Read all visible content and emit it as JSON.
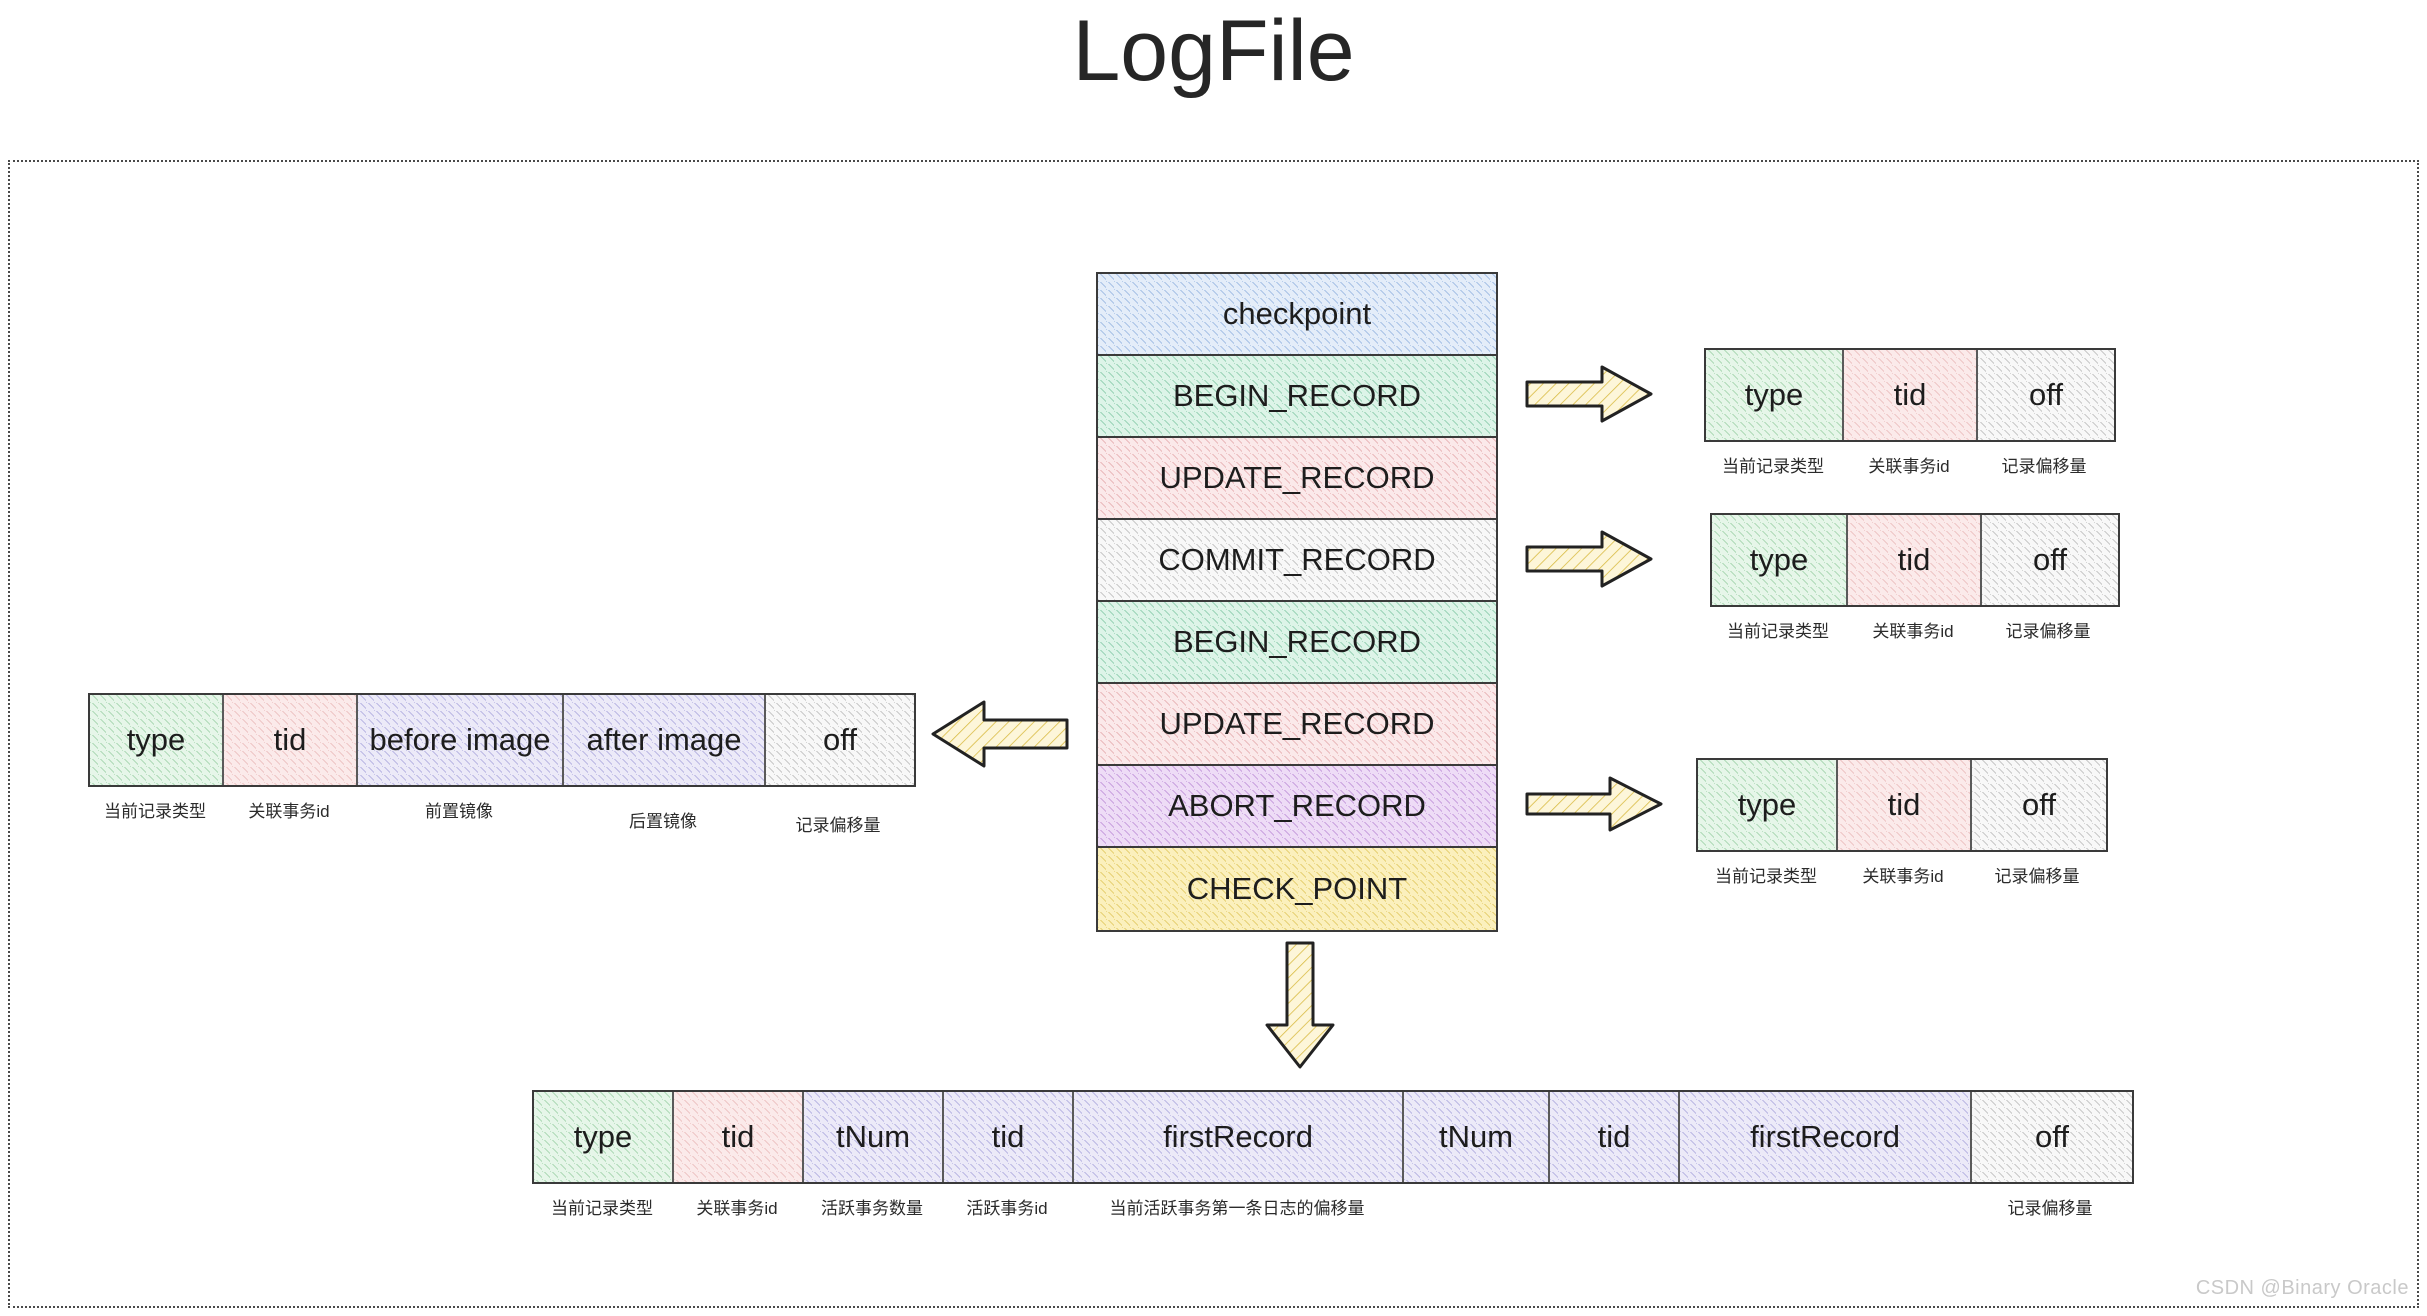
{
  "title": "LogFile",
  "watermark": "CSDN @Binary Oracle",
  "log_stack": {
    "name": "log-file-stack",
    "rows": [
      {
        "label": "checkpoint",
        "fill": "#e4edf9"
      },
      {
        "label": "BEGIN_RECORD",
        "fill": "#ddf4e8"
      },
      {
        "label": "UPDATE_RECORD",
        "fill": "#fbe9ea"
      },
      {
        "label": "COMMIT_RECORD",
        "fill": "#f8f8f8"
      },
      {
        "label": "BEGIN_RECORD",
        "fill": "#ddf4e8"
      },
      {
        "label": "UPDATE_RECORD",
        "fill": "#fbe9ea"
      },
      {
        "label": "ABORT_RECORD",
        "fill": "#eedcf6"
      },
      {
        "label": "CHECK_POINT",
        "fill": "#fbf0bd"
      }
    ]
  },
  "records": {
    "begin_record": {
      "title": "BEGIN_RECORD",
      "fields": [
        {
          "name": "type",
          "caption": "当前记录类型"
        },
        {
          "name": "tid",
          "caption": "关联事务id"
        },
        {
          "name": "off",
          "caption": "记录偏移量"
        }
      ]
    },
    "commit_record": {
      "title": "COMMIT_RECORD",
      "fields": [
        {
          "name": "type",
          "caption": "当前记录类型"
        },
        {
          "name": "tid",
          "caption": "关联事务id"
        },
        {
          "name": "off",
          "caption": "记录偏移量"
        }
      ]
    },
    "abort_record": {
      "title": "ABORT_RECORD",
      "fields": [
        {
          "name": "type",
          "caption": "当前记录类型"
        },
        {
          "name": "tid",
          "caption": "关联事务id"
        },
        {
          "name": "off",
          "caption": "记录偏移量"
        }
      ]
    },
    "update_record": {
      "title": "UPDATE_RECORD",
      "fields": [
        {
          "name": "type",
          "caption": "当前记录类型"
        },
        {
          "name": "tid",
          "caption": "关联事务id"
        },
        {
          "name": "before image",
          "caption": "前置镜像"
        },
        {
          "name": "after image",
          "caption": "后置镜像"
        },
        {
          "name": "off",
          "caption": "记录偏移量"
        }
      ]
    },
    "check_point_record": {
      "title": "CHECK_POINT",
      "fields": [
        {
          "name": "type",
          "caption": "当前记录类型"
        },
        {
          "name": "tid",
          "caption": "关联事务id"
        },
        {
          "name": "tNum",
          "caption": "活跃事务数量"
        },
        {
          "name": "tid",
          "caption": "活跃事务id"
        },
        {
          "name": "firstRecord",
          "caption": "当前活跃事务第一条日志的偏移量"
        },
        {
          "name": "tNum",
          "caption": ""
        },
        {
          "name": "tid",
          "caption": ""
        },
        {
          "name": "firstRecord",
          "caption": ""
        },
        {
          "name": "off",
          "caption": "记录偏移量"
        }
      ]
    }
  },
  "arrows": {
    "to_begin_record": "arrow-right-icon",
    "to_commit_record": "arrow-right-icon",
    "to_abort_record": "arrow-right-icon",
    "to_update_record": "arrow-left-icon",
    "to_check_point_record": "arrow-down-icon"
  },
  "colors": {
    "checkpoint": "#e4edf9",
    "begin": "#ddf4e8",
    "update": "#fbe9ea",
    "commit": "#f8f8f8",
    "abort": "#eedcf6",
    "check_point": "#fbf0bd",
    "image_field": "#eceaf8",
    "arrow_fill": "#fdf6d9",
    "stroke": "#3a3a3a"
  }
}
